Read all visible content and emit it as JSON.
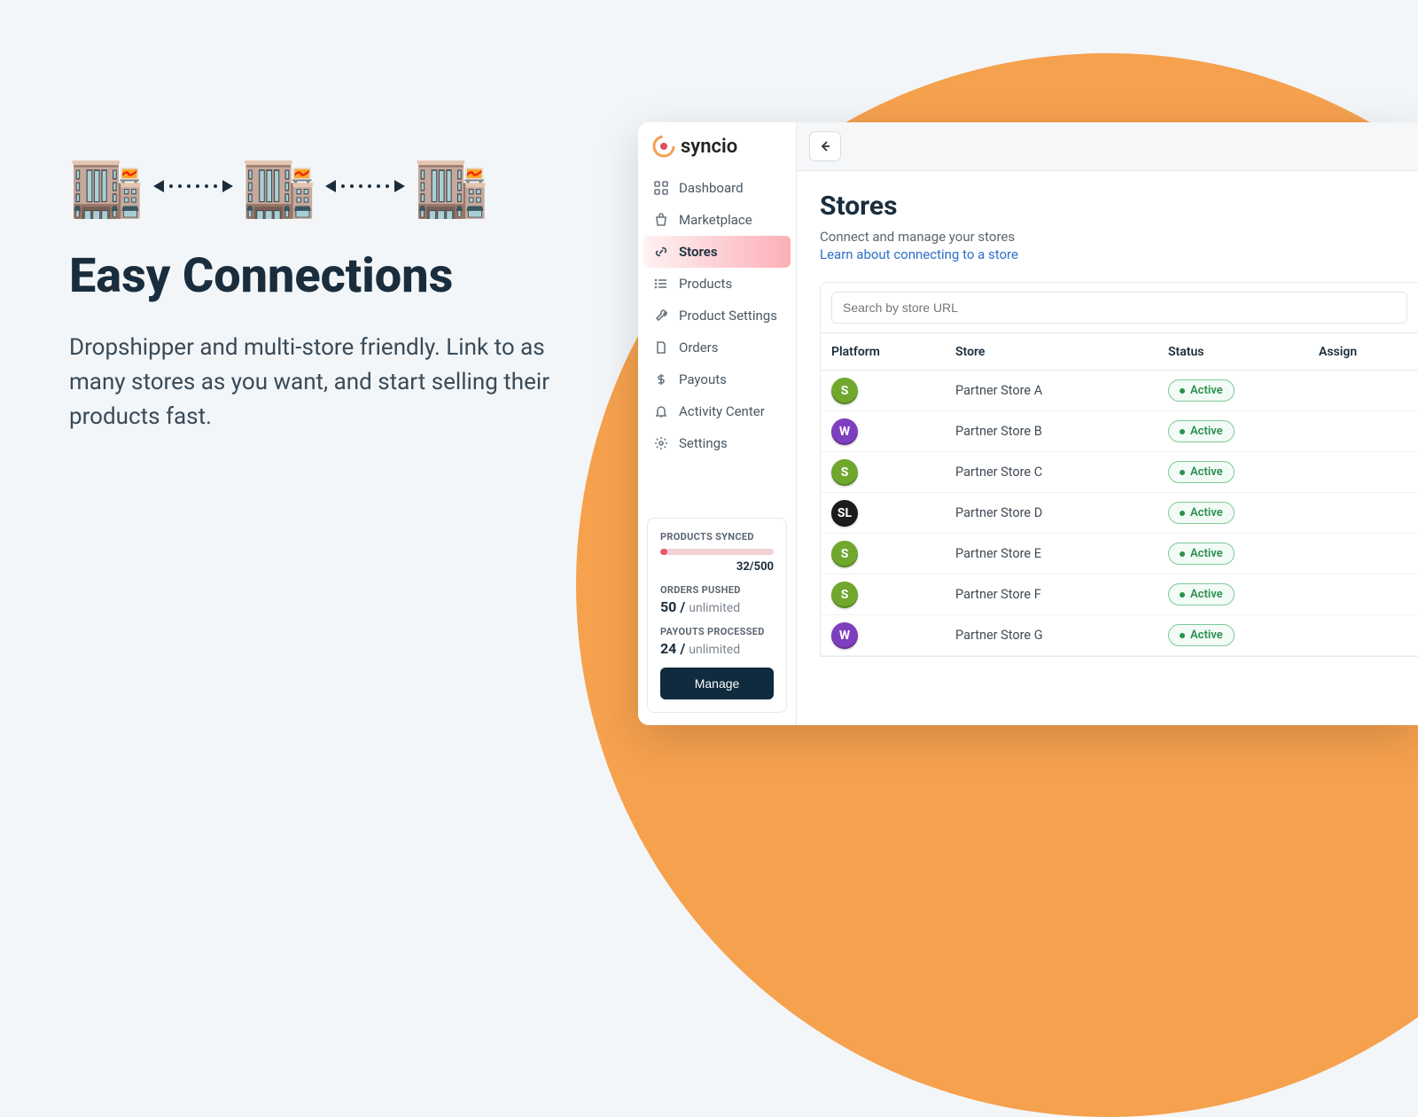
{
  "marketing": {
    "heading": "Easy Connections",
    "body": "Dropshipper and multi-store friendly. Link to as many stores as you want, and start selling their products fast."
  },
  "brand": {
    "name": "syncio"
  },
  "nav": [
    {
      "label": "Dashboard"
    },
    {
      "label": "Marketplace"
    },
    {
      "label": "Stores"
    },
    {
      "label": "Products"
    },
    {
      "label": "Product Settings"
    },
    {
      "label": "Orders"
    },
    {
      "label": "Payouts"
    },
    {
      "label": "Activity Center"
    },
    {
      "label": "Settings"
    }
  ],
  "stats": {
    "productsLabel": "PRODUCTS SYNCED",
    "productsText": "32/500",
    "ordersLabel": "ORDERS PUSHED",
    "ordersValue": "50 /",
    "ordersUnit": "unlimited",
    "payoutsLabel": "PAYOUTS PROCESSED",
    "payoutsValue": "24 /",
    "payoutsUnit": "unlimited",
    "manageLabel": "Manage"
  },
  "page": {
    "title": "Stores",
    "subtitle": "Connect and manage your stores",
    "learnLink": "Learn about connecting to a store",
    "searchPlaceholder": "Search by store URL"
  },
  "columns": {
    "platform": "Platform",
    "store": "Store",
    "status": "Status",
    "assign": "Assign"
  },
  "statusActive": "Active",
  "rows": [
    {
      "badge": "S",
      "color": "#6fa82d",
      "store": "Partner Store A"
    },
    {
      "badge": "W",
      "color": "#7e3fbf",
      "store": "Partner Store B"
    },
    {
      "badge": "S",
      "color": "#6fa82d",
      "store": "Partner Store C"
    },
    {
      "badge": "SL",
      "color": "#1c1c1c",
      "store": "Partner Store D"
    },
    {
      "badge": "S",
      "color": "#6fa82d",
      "store": "Partner Store E"
    },
    {
      "badge": "S",
      "color": "#6fa82d",
      "store": "Partner Store F"
    },
    {
      "badge": "W",
      "color": "#7e3fbf",
      "store": "Partner Store G"
    }
  ]
}
